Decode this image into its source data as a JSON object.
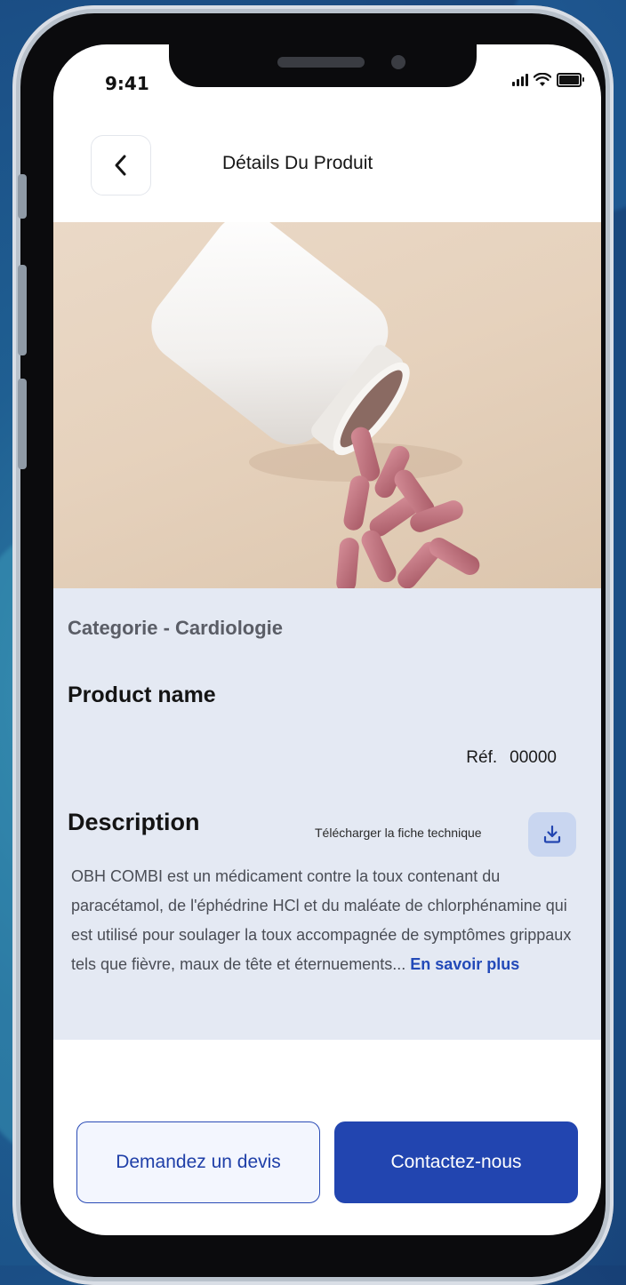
{
  "status_bar": {
    "time": "9:41"
  },
  "header": {
    "title": "Détails Du Produit"
  },
  "product": {
    "category": "Categorie - Cardiologie",
    "name": "Product name",
    "ref_label": "Réf.",
    "ref_value": "00000"
  },
  "description": {
    "title": "Description",
    "download_label": "Télécharger la fiche technique",
    "text": "OBH COMBI est un médicament contre la toux contenant du paracétamol, de l'éphédrine HCl et du maléate de chlorphénamine qui est utilisé pour soulager la toux accompagnée de symptômes grippaux tels que fièvre, maux de tête et éternuements...",
    "more_link": "En savoir plus"
  },
  "actions": {
    "quote_label": "Demandez un devis",
    "contact_label": "Contactez-nous"
  },
  "colors": {
    "primary": "#2245b0",
    "details_bg": "#e4e9f3",
    "link": "#2249b8"
  },
  "icons": [
    "back-chevron-icon",
    "signal-icon",
    "wifi-icon",
    "battery-icon",
    "download-icon"
  ]
}
